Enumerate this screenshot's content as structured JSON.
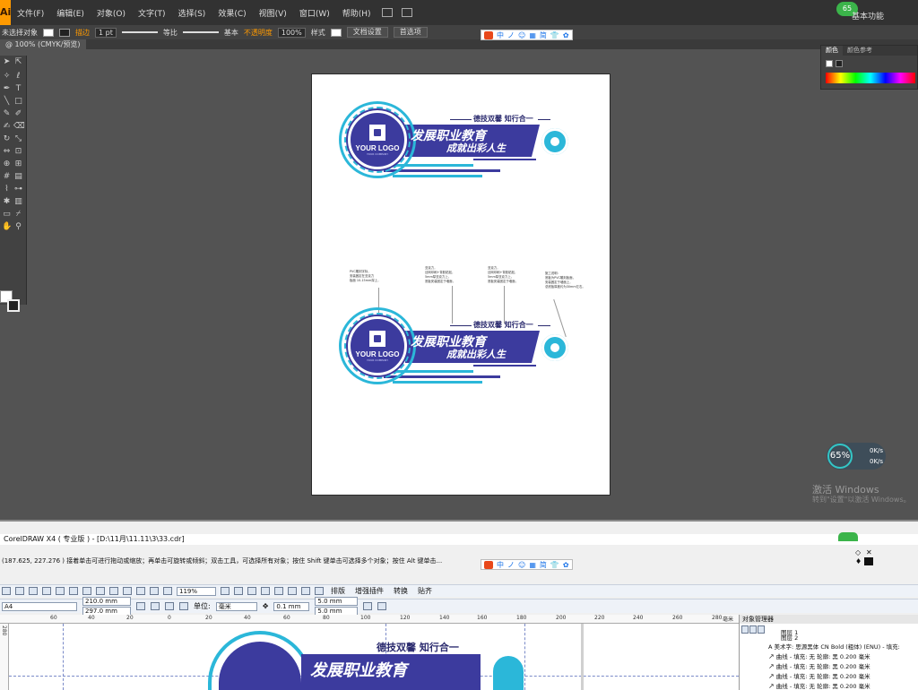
{
  "illustrator": {
    "app_icon": "Ai",
    "menu": [
      "文件(F)",
      "编辑(E)",
      "对象(O)",
      "文字(T)",
      "选择(S)",
      "效果(C)",
      "视图(V)",
      "窗口(W)",
      "帮助(H)"
    ],
    "workspace": "基本功能",
    "avatar_badge": "65",
    "control": {
      "selection": "未选择对象",
      "tab_label": "描边",
      "stroke_weight": "1 pt",
      "profile_label": "等比",
      "brush_label": "基本",
      "opacity_label": "不透明度",
      "opacity_value": "100%",
      "style_label": "样式",
      "doc_setup_btn": "文档设置",
      "prefs_btn": "首选项"
    },
    "doc_tab": "@ 100% (CMYK/预览)",
    "color_panel": {
      "tab_color": "颜色",
      "tab_guide": "颜色参考"
    },
    "signboard": {
      "logo_text": "YOUR LOGO",
      "logo_sub": "YOUR COMPANY",
      "motto": "德技双馨  知行合一",
      "slogan_line1": "发展职业教育",
      "slogan_line2": "成就出彩人生"
    },
    "notes": [
      "PVC雕刻字标，\n安装固定在亚克力\n板面 10-15mm厚上，",
      "亚克力，\n丝网印刷+背胶粘贴，\n5mm厚亚克力上，\n底板安装固定于墙面，",
      "亚克力，\n丝网印刷+背胶粘贴，\n5mm厚亚克力上，\n底板安装固定于墙面，",
      "施工说明：\n底板为PVC雕刻板面，\n安装固定于墙面上，\n总底板厚度约为30mm左右。"
    ],
    "activate": {
      "title": "激活 Windows",
      "subtitle": "转到\"设置\"以激活 Windows。"
    },
    "meter": {
      "percent": "65%",
      "up": "0K/s",
      "down": "0K/s"
    }
  },
  "float_toolbar": [
    "中",
    "ノ",
    "☺",
    "▦",
    "简",
    "👕",
    "✿"
  ],
  "coreldraw": {
    "title": "CorelDRAW X4 ( 专业版 ) - [D:\\11月\\11.11\\3\\33.cdr]",
    "status": "(187.625, 227.276 )    接着单击可进行拖动或缩放；再单击可旋转或倾斜；双击工具，可选择所有对象；按住 Shift 键单击可选择多个对象；按住 Alt 键单击...",
    "zoom": "119%",
    "menu_items": [
      "排版",
      "增强插件",
      "转换",
      "贴齐"
    ],
    "page_preset": "A4",
    "width": "210.0 mm",
    "height": "297.0 mm",
    "units_label": "单位:",
    "units_value": "毫米",
    "nudge": "0.1 mm",
    "dup_x": "5.0 mm",
    "dup_y": "5.0 mm",
    "ruler_ticks": [
      "60",
      "40",
      "20",
      "0",
      "20",
      "40",
      "60",
      "80",
      "100",
      "120",
      "140",
      "160",
      "180",
      "200",
      "220",
      "240",
      "260",
      "280"
    ],
    "ruler_unit": "毫米",
    "vruler_tick": "280",
    "object_manager": {
      "title": "对象管理器",
      "layer1": "图层 1",
      "layer2": "图层 2",
      "rows": [
        "美术字: 思源黑体 CN Bold (粗体) (ENU) - 填充:",
        "曲线 - 填充: 无  轮廓: 黑  0.200 毫米",
        "曲线 - 填充: 无  轮廓: 黑  0.200 毫米",
        "曲线 - 填充: 无  轮廓: 黑  0.200 毫米",
        "曲线 - 填充: 无  轮廓: 黑  0.200 毫米"
      ]
    },
    "canvas_sign": {
      "motto": "德技双馨  知行合一",
      "slogan": "发展职业教育"
    }
  },
  "colors": {
    "ai_bg": "#535353",
    "ai_bar": "#323232",
    "brand_blue": "#3c3b9e",
    "brand_cyan": "#2bb7d9",
    "ai_orange": "#ff9a00"
  }
}
